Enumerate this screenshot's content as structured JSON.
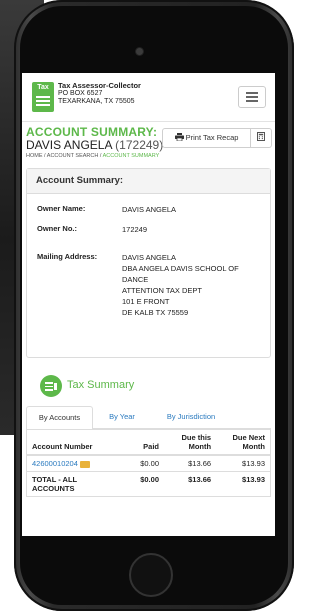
{
  "header": {
    "logo_text": "Tax",
    "org_name": "Tax Assessor-Collector",
    "org_address1": "PO BOX 6527",
    "org_address2": "TEXARKANA, TX 75505"
  },
  "title": {
    "heading": "ACCOUNT SUMMARY:",
    "name": "DAVIS ANGELA",
    "account_no": "(172249)"
  },
  "breadcrumb": {
    "home": "HOME",
    "sep1": " / ",
    "search": "ACCOUNT SEARCH",
    "sep2": " / ",
    "current": "ACCOUNT SUMMARY"
  },
  "toolbar": {
    "print_label": "Print Tax Recap",
    "print_icon": "printer-icon",
    "calc_icon": "calculator-icon"
  },
  "summary": {
    "heading": "Account Summary:",
    "owner_name_label": "Owner Name:",
    "owner_name_value": "DAVIS ANGELA",
    "owner_no_label": "Owner No.:",
    "owner_no_value": "172249",
    "mailing_label": "Mailing Address:",
    "mailing_lines": [
      "DAVIS ANGELA",
      "DBA ANGELA DAVIS SCHOOL OF",
      "DANCE",
      "ATTENTION TAX DEPT",
      "101 E FRONT",
      "DE KALB TX 75559"
    ]
  },
  "tax_summary": {
    "heading": "Tax Summary",
    "tabs": [
      "By Accounts",
      "By Year",
      "By Jurisdiction"
    ],
    "columns": [
      "Account Number",
      "Paid",
      "Due this Month",
      "Due Next Month"
    ],
    "rows": [
      {
        "account": "42600010204",
        "paid": "$0.00",
        "due_this": "$13.66",
        "due_next": "$13.93"
      },
      {
        "account": "TOTAL - ALL ACCOUNTS",
        "paid": "$0.00",
        "due_this": "$13.66",
        "due_next": "$13.93"
      }
    ]
  },
  "colors": {
    "accent_green": "#5db84a",
    "link_blue": "#2a7abf",
    "folder_yellow": "#e9b23a"
  }
}
